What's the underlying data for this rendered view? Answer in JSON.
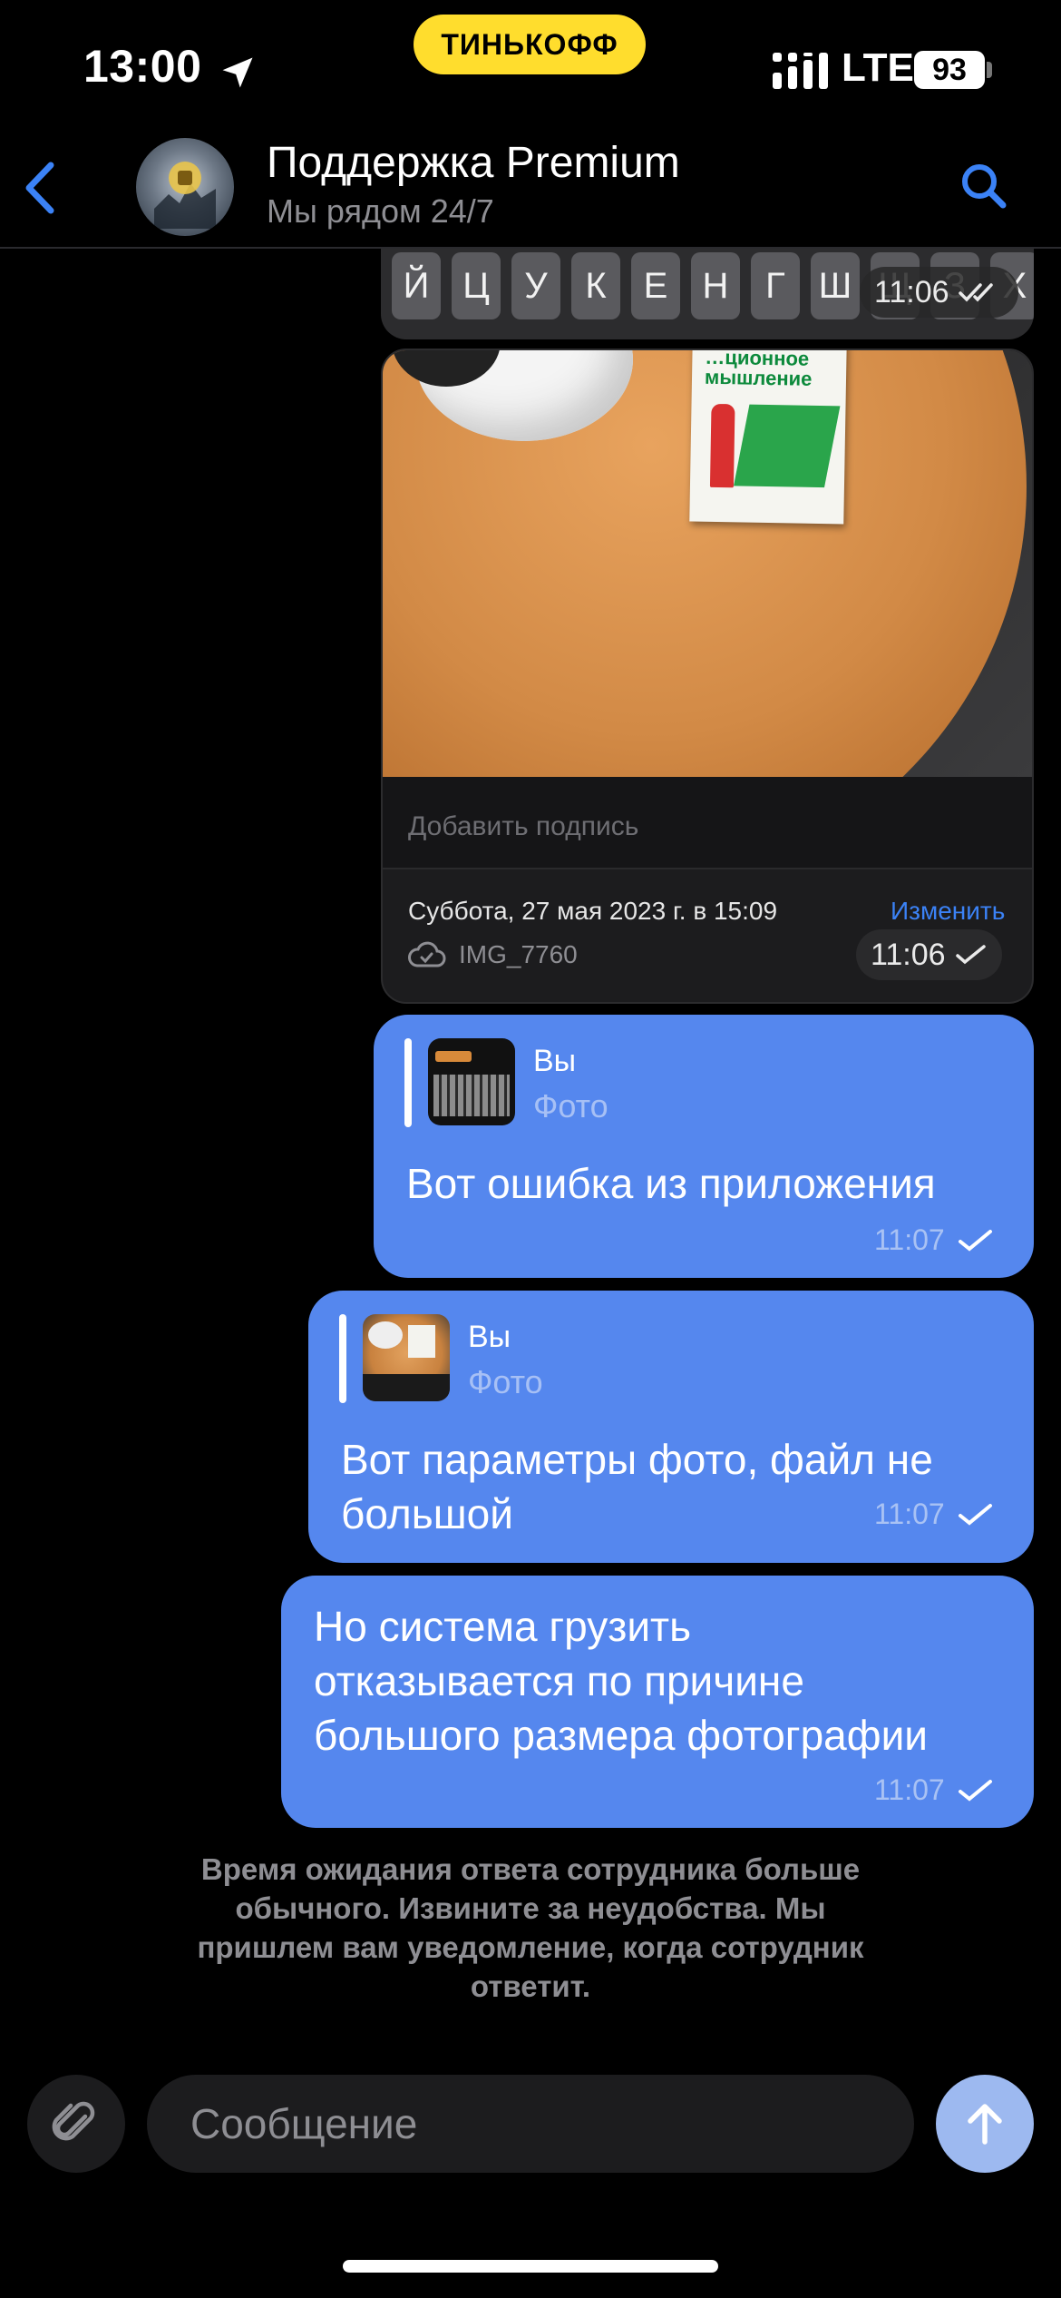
{
  "status_bar": {
    "time": "13:00",
    "carrier_badge": "ТИНЬКОФФ",
    "network": "LTE",
    "battery": "93",
    "accent": "#FFDD2D"
  },
  "header": {
    "title": "Поддержка Premium",
    "subtitle": "Мы рядом 24/7",
    "accent": "#3B82F6"
  },
  "messages": {
    "keyboard_screenshot": {
      "keys": [
        "Й",
        "Ц",
        "У",
        "К",
        "Е",
        "Н",
        "Г",
        "Ш",
        "Щ",
        "З",
        "Х"
      ],
      "time": "11:06"
    },
    "photo_info": {
      "caption_placeholder": "Добавить подпись",
      "date": "Суббота, 27 мая 2023 г. в 15:09",
      "edit": "Изменить",
      "filename": "IMG_7760",
      "time": "11:06",
      "book_title": "…ционное мышление"
    },
    "reply1": {
      "author": "Вы",
      "type": "Фото",
      "text": "Вот ошибка из приложения",
      "time": "11:07"
    },
    "reply2": {
      "author": "Вы",
      "type": "Фото",
      "text_line1": "Вот параметры фото, файл не",
      "text_line2": "большой",
      "time": "11:07"
    },
    "text3": {
      "line1": "Но система грузить",
      "line2": "отказывается по причине",
      "line3": "большого размера фотографии",
      "time": "11:07"
    },
    "bubble_color": "#5587EE"
  },
  "system_notice": {
    "line1": "Время ожидания ответа сотрудника больше",
    "line2": "обычного. Извините за неудобства. Мы",
    "line3": "пришлем вам уведомление, когда сотрудник",
    "line4": "ответит."
  },
  "composer": {
    "placeholder": "Сообщение"
  },
  "icons": [
    "location-arrow-icon",
    "signal-icon",
    "battery-icon",
    "back-chevron-icon",
    "search-icon",
    "double-check-icon",
    "check-icon",
    "cloud-icon",
    "paperclip-icon",
    "send-arrow-icon"
  ]
}
